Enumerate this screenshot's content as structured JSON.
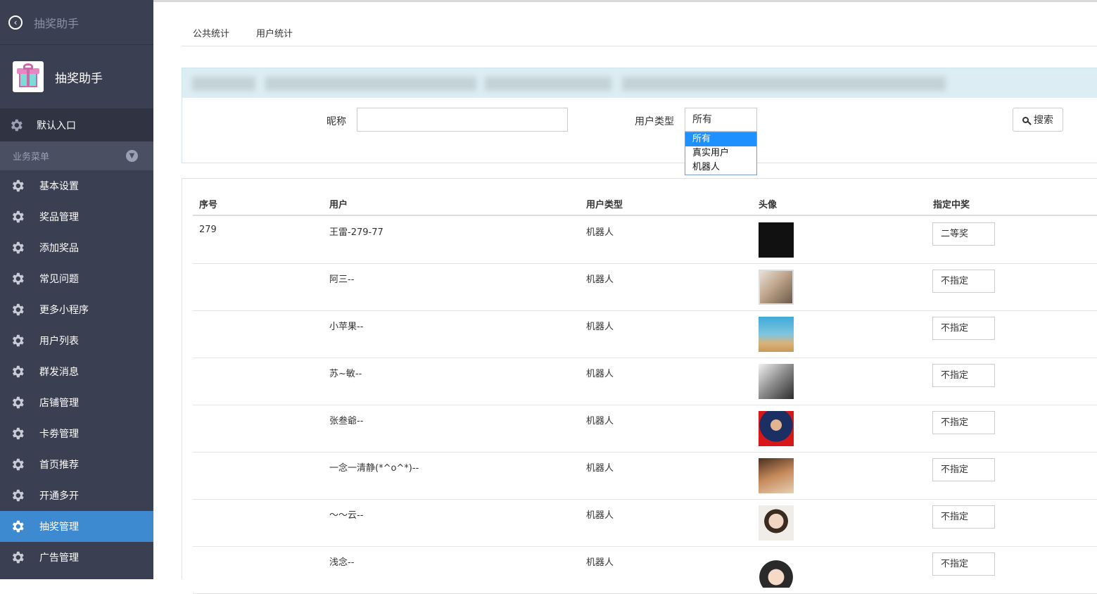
{
  "sidebar": {
    "header_title": "抽奖助手",
    "brand_name": "抽奖助手",
    "default_entry": "默认入口",
    "group_label": "业务菜单",
    "items": [
      {
        "label": "基本设置",
        "active": false
      },
      {
        "label": "奖品管理",
        "active": false
      },
      {
        "label": "添加奖品",
        "active": false
      },
      {
        "label": "常见问题",
        "active": false
      },
      {
        "label": "更多小程序",
        "active": false
      },
      {
        "label": "用户列表",
        "active": false
      },
      {
        "label": "群发消息",
        "active": false
      },
      {
        "label": "店铺管理",
        "active": false
      },
      {
        "label": "卡劵管理",
        "active": false
      },
      {
        "label": "首页推荐",
        "active": false
      },
      {
        "label": "开通多开",
        "active": false
      },
      {
        "label": "抽奖管理",
        "active": true
      },
      {
        "label": "广告管理",
        "active": false
      }
    ]
  },
  "tabs": [
    {
      "label": "公共统计"
    },
    {
      "label": "用户统计"
    }
  ],
  "filter": {
    "nickname_label": "昵称",
    "nickname_value": "",
    "user_type_label": "用户类型",
    "user_type_value": "所有",
    "user_type_options": [
      "所有",
      "真实用户",
      "机器人"
    ],
    "search_label": "搜索"
  },
  "table": {
    "headers": [
      "序号",
      "用户",
      "用户类型",
      "头像",
      "指定中奖"
    ],
    "rows": [
      {
        "index": "279",
        "user": "王雷-279-77",
        "type": "机器人",
        "prize": "二等奖"
      },
      {
        "index": "",
        "user": "阿三--",
        "type": "机器人",
        "prize": "不指定"
      },
      {
        "index": "",
        "user": "小苹果--",
        "type": "机器人",
        "prize": "不指定"
      },
      {
        "index": "",
        "user": "苏~敏--",
        "type": "机器人",
        "prize": "不指定"
      },
      {
        "index": "",
        "user": "张叁爺--",
        "type": "机器人",
        "prize": "不指定"
      },
      {
        "index": "",
        "user": "一念一清静(*^o^*)--",
        "type": "机器人",
        "prize": "不指定"
      },
      {
        "index": "",
        "user": "～～云--",
        "type": "机器人",
        "prize": "不指定"
      },
      {
        "index": "",
        "user": "浅念--",
        "type": "机器人",
        "prize": "不指定"
      }
    ]
  },
  "colors": {
    "sidebar_bg": "#3a3f51",
    "active_item": "#3e8ad1",
    "dropdown_selected": "#1e90ff"
  }
}
